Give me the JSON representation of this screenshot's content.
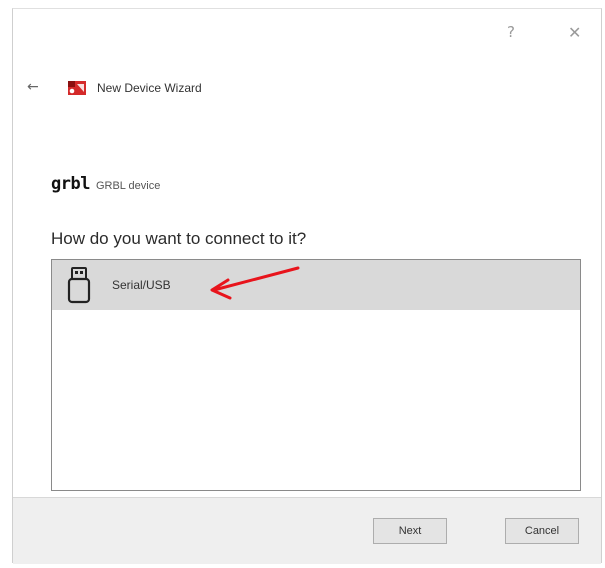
{
  "window": {
    "title": "New Device Wizard",
    "help_glyph": "?",
    "close_glyph": "✕",
    "back_glyph": "←"
  },
  "device": {
    "logo_text": "grbl",
    "name": "GRBL device"
  },
  "prompt": {
    "question": "How do you want to connect to it?"
  },
  "connection_options": [
    {
      "label": "Serial/USB",
      "icon": "usb-drive-icon",
      "selected": true
    }
  ],
  "buttons": {
    "next": "Next",
    "cancel": "Cancel"
  },
  "colors": {
    "selection_bg": "#d9d9d9",
    "annotation_arrow": "#e8141c",
    "logo_red": "#d42a2a"
  }
}
